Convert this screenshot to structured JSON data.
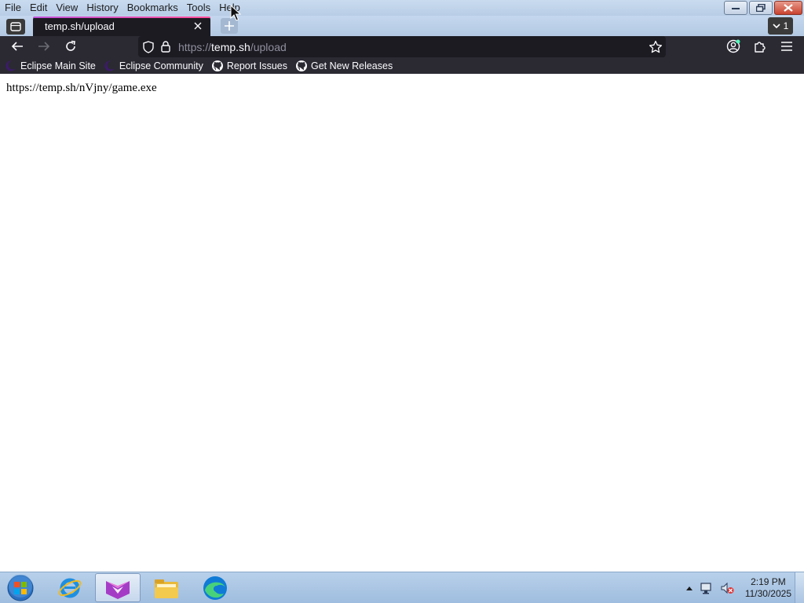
{
  "menu": {
    "items": [
      {
        "label": "File"
      },
      {
        "label": "Edit"
      },
      {
        "label": "View"
      },
      {
        "label": "History"
      },
      {
        "label": "Bookmarks"
      },
      {
        "label": "Tools"
      },
      {
        "label": "Help"
      }
    ]
  },
  "tabs": {
    "active_title": "temp.sh/upload",
    "tab_count": "1"
  },
  "navbar": {
    "url_prefix": "https://",
    "url_host": "temp.sh",
    "url_path": "/upload"
  },
  "bookmarks": [
    {
      "label": "Eclipse Main Site",
      "icon": "eclipse-icon"
    },
    {
      "label": "Eclipse Community",
      "icon": "eclipse-icon"
    },
    {
      "label": "Report Issues",
      "icon": "github-icon"
    },
    {
      "label": "Get New Releases",
      "icon": "github-icon"
    }
  ],
  "content": {
    "result_text": "https://temp.sh/nVjny/game.exe"
  },
  "taskbar": {
    "apps": [
      "internet-explorer-icon",
      "browser-icon",
      "file-explorer-icon",
      "edge-icon"
    ],
    "time": "2:19 PM",
    "date": "11/30/2025"
  },
  "colors": {
    "toolbar_bg": "#2b2a33",
    "urlbar_bg": "#1c1b22",
    "tab_accent": "#c052d9"
  }
}
